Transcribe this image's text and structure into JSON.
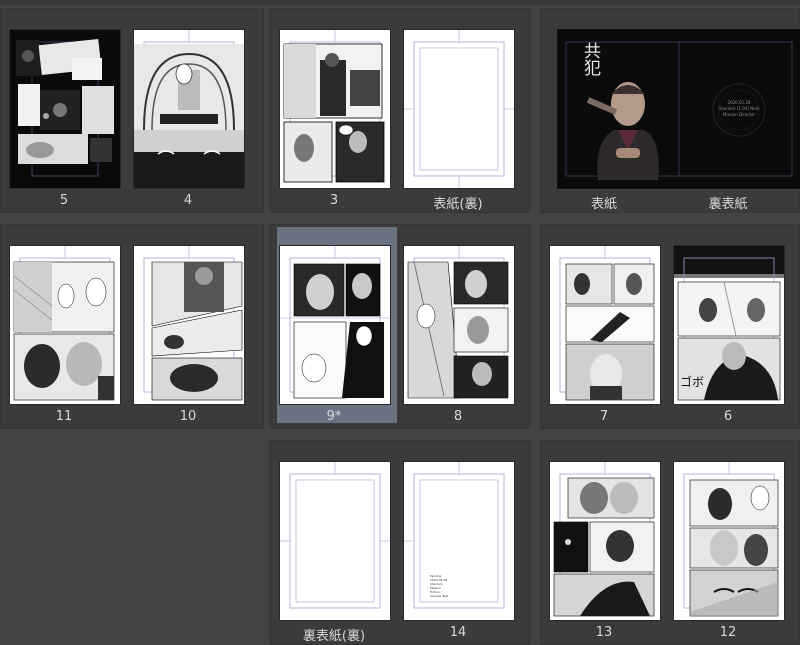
{
  "colors": {
    "background": "#434343",
    "spread": "#3b3b3b",
    "selected": "#6a7384",
    "guide": "#9ea5d6",
    "label": "#d8d8d8"
  },
  "cover": {
    "title_vertical": "共犯",
    "back_cover_text": [
      "2020.02.28",
      "Sherlock (1.00) Nem",
      "Mission Director"
    ]
  },
  "colophon_text": [
    "Fanzine",
    "2020.02.28",
    "Sherlock",
    "Mission",
    "Fiction",
    "Sample Text"
  ],
  "spreads": [
    {
      "row": 0,
      "col": 0,
      "left_label": "5",
      "right_label": "4"
    },
    {
      "row": 0,
      "col": 1,
      "left_label": "3",
      "right_label": "表紙(裏)"
    },
    {
      "row": 0,
      "col": 2,
      "left_label": "表紙",
      "right_label": "裏表紙"
    },
    {
      "row": 1,
      "col": 0,
      "left_label": "11",
      "right_label": "10"
    },
    {
      "row": 1,
      "col": 1,
      "left_label": "9*",
      "right_label": "8",
      "selected": "left"
    },
    {
      "row": 1,
      "col": 2,
      "left_label": "7",
      "right_label": "6"
    },
    {
      "row": 2,
      "col": 1,
      "left_label": "裏表紙(裏)",
      "right_label": "14"
    },
    {
      "row": 2,
      "col": 2,
      "left_label": "13",
      "right_label": "12"
    }
  ]
}
